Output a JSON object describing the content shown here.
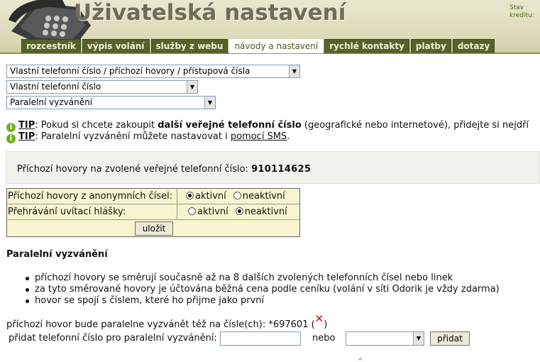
{
  "header": {
    "title": "Uživatelská nastavení",
    "credit_line1": "Stav",
    "credit_line2": "kreditu:"
  },
  "tabs": [
    {
      "label": "rozcestník",
      "active": false
    },
    {
      "label": "výpis volání",
      "active": false
    },
    {
      "label": "služby z webu",
      "active": false
    },
    {
      "label": "návody a nastavení",
      "active": true
    },
    {
      "label": "rychlé kontakty",
      "active": false
    },
    {
      "label": "platby",
      "active": false
    },
    {
      "label": "dotazy",
      "active": false
    }
  ],
  "selects": {
    "category": "Vlastní telefonní číslo / příchozí hovory / přístupová čísla",
    "subcategory": "Vlastní telefonní číslo",
    "topic": "Paralelní vyzvánění"
  },
  "tips": {
    "tip_label": "TIP",
    "tip1_before": ": Pokud si chcete zakoupit ",
    "tip1_bold": "další veřejné telefonní číslo",
    "tip1_after": " (geografické nebo internetové), přidejte si nejdří",
    "tip2_before": ": Paralelní vyzvánění můžete nastavovat i ",
    "tip2_link": "pomocí SMS",
    "tip2_after": "."
  },
  "info": {
    "text": "Příchozí hovory na zvolené veřejné telefonní číslo: ",
    "number": "910114625"
  },
  "settings": {
    "anonymous_label": "Příchozí hovory z anonymních čísel:",
    "greeting_label": "Přehrávání uvítací hlášky:",
    "active": "aktivní",
    "inactive": "neaktivní",
    "anonymous_value": "aktivní",
    "greeting_value": "neaktivní",
    "save": "uložit"
  },
  "section": {
    "title": "Paralelní vyzvánění",
    "bullets": [
      "příchozí hovory se směrují současně až na 8 dalších zvolených telefonních čísel nebo linek",
      "za tyto směrované hovory je účtována běžná cena podle ceníku (volání v síti Odorik je vždy zdarma)",
      "hovor se spojí s číslem, které ho přijme jako první"
    ],
    "parallel_text": "příchozí hovor bude paralelne vyzvánět též na čísle(ch): *697601 (",
    "parallel_close": ")",
    "add_label": "přidat telefonní číslo pro paralelní vyzvánění:",
    "add_value": "",
    "or": "nebo",
    "add_select_value": "",
    "add_button": "přidat"
  }
}
